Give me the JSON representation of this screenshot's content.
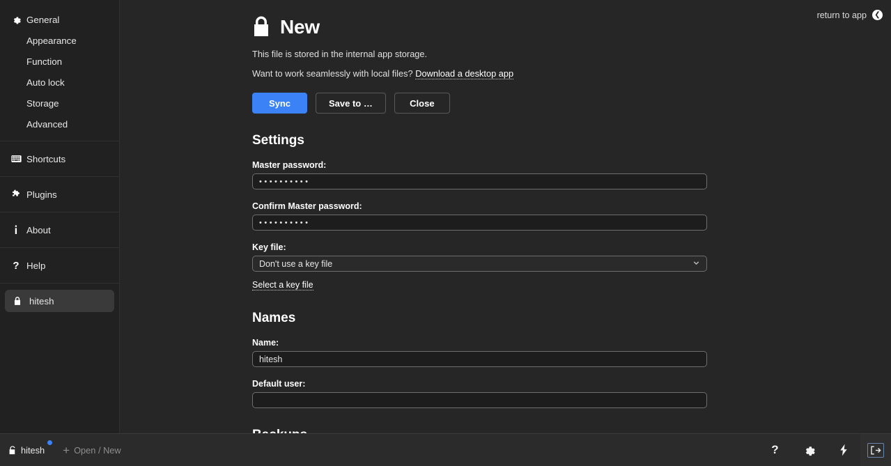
{
  "window": {
    "title": "New"
  },
  "sidebar": {
    "groups": [
      {
        "items": [
          {
            "label": "General",
            "icon": "gear-icon",
            "sub": false,
            "active": false
          },
          {
            "label": "Appearance",
            "icon": "",
            "sub": true,
            "active": false
          },
          {
            "label": "Function",
            "icon": "",
            "sub": true,
            "active": false
          },
          {
            "label": "Auto lock",
            "icon": "",
            "sub": true,
            "active": false
          },
          {
            "label": "Storage",
            "icon": "",
            "sub": true,
            "active": false
          },
          {
            "label": "Advanced",
            "icon": "",
            "sub": true,
            "active": false
          }
        ]
      },
      {
        "items": [
          {
            "label": "Shortcuts",
            "icon": "keyboard-icon",
            "sub": false,
            "active": false
          }
        ]
      },
      {
        "items": [
          {
            "label": "Plugins",
            "icon": "puzzle-icon",
            "sub": false,
            "active": false
          }
        ]
      },
      {
        "items": [
          {
            "label": "About",
            "icon": "info-icon",
            "sub": false,
            "active": false
          }
        ]
      },
      {
        "items": [
          {
            "label": "Help",
            "icon": "question-icon",
            "sub": false,
            "active": false
          }
        ]
      },
      {
        "items": [
          {
            "label": "hitesh",
            "icon": "lock-icon",
            "sub": false,
            "active": true
          }
        ]
      }
    ]
  },
  "header": {
    "return_label": "return to app",
    "return_icon": "circle-left-arrow-icon",
    "lock_icon": "lock-closed-icon",
    "title": "New"
  },
  "notice": {
    "storage_line": "This file is stored in the internal app storage.",
    "desktop_prompt": "Want to work seamlessly with local files?",
    "desktop_link": "Download a desktop app"
  },
  "actions": {
    "sync": "Sync",
    "save_to": "Save to …",
    "close": "Close",
    "primary_color": "#3b82f6"
  },
  "settings": {
    "heading": "Settings",
    "master_password_label": "Master password:",
    "master_password_value": "••••••••••",
    "confirm_password_label": "Confirm Master password:",
    "confirm_password_value": "••••••••••",
    "key_file_label": "Key file:",
    "key_file_selected": "Don't use a key file",
    "key_file_options": [
      "Don't use a key file"
    ],
    "select_key_file_link": "Select a key file"
  },
  "names": {
    "heading": "Names",
    "name_label": "Name:",
    "name_value": "hitesh",
    "default_user_label": "Default user:",
    "default_user_value": ""
  },
  "backups": {
    "heading": "Backups"
  },
  "statusbar": {
    "open_file": {
      "label": "hitesh",
      "icon": "unlocked-padlock-icon",
      "badge": true
    },
    "open_new": {
      "label": "Open / New",
      "icon": "plus-icon"
    },
    "tools": [
      {
        "name": "help-icon",
        "glyph": "?"
      },
      {
        "name": "gear-icon",
        "glyph": "gear"
      },
      {
        "name": "lightning-icon",
        "glyph": "bolt"
      },
      {
        "name": "exit-icon",
        "glyph": "exit"
      }
    ]
  }
}
